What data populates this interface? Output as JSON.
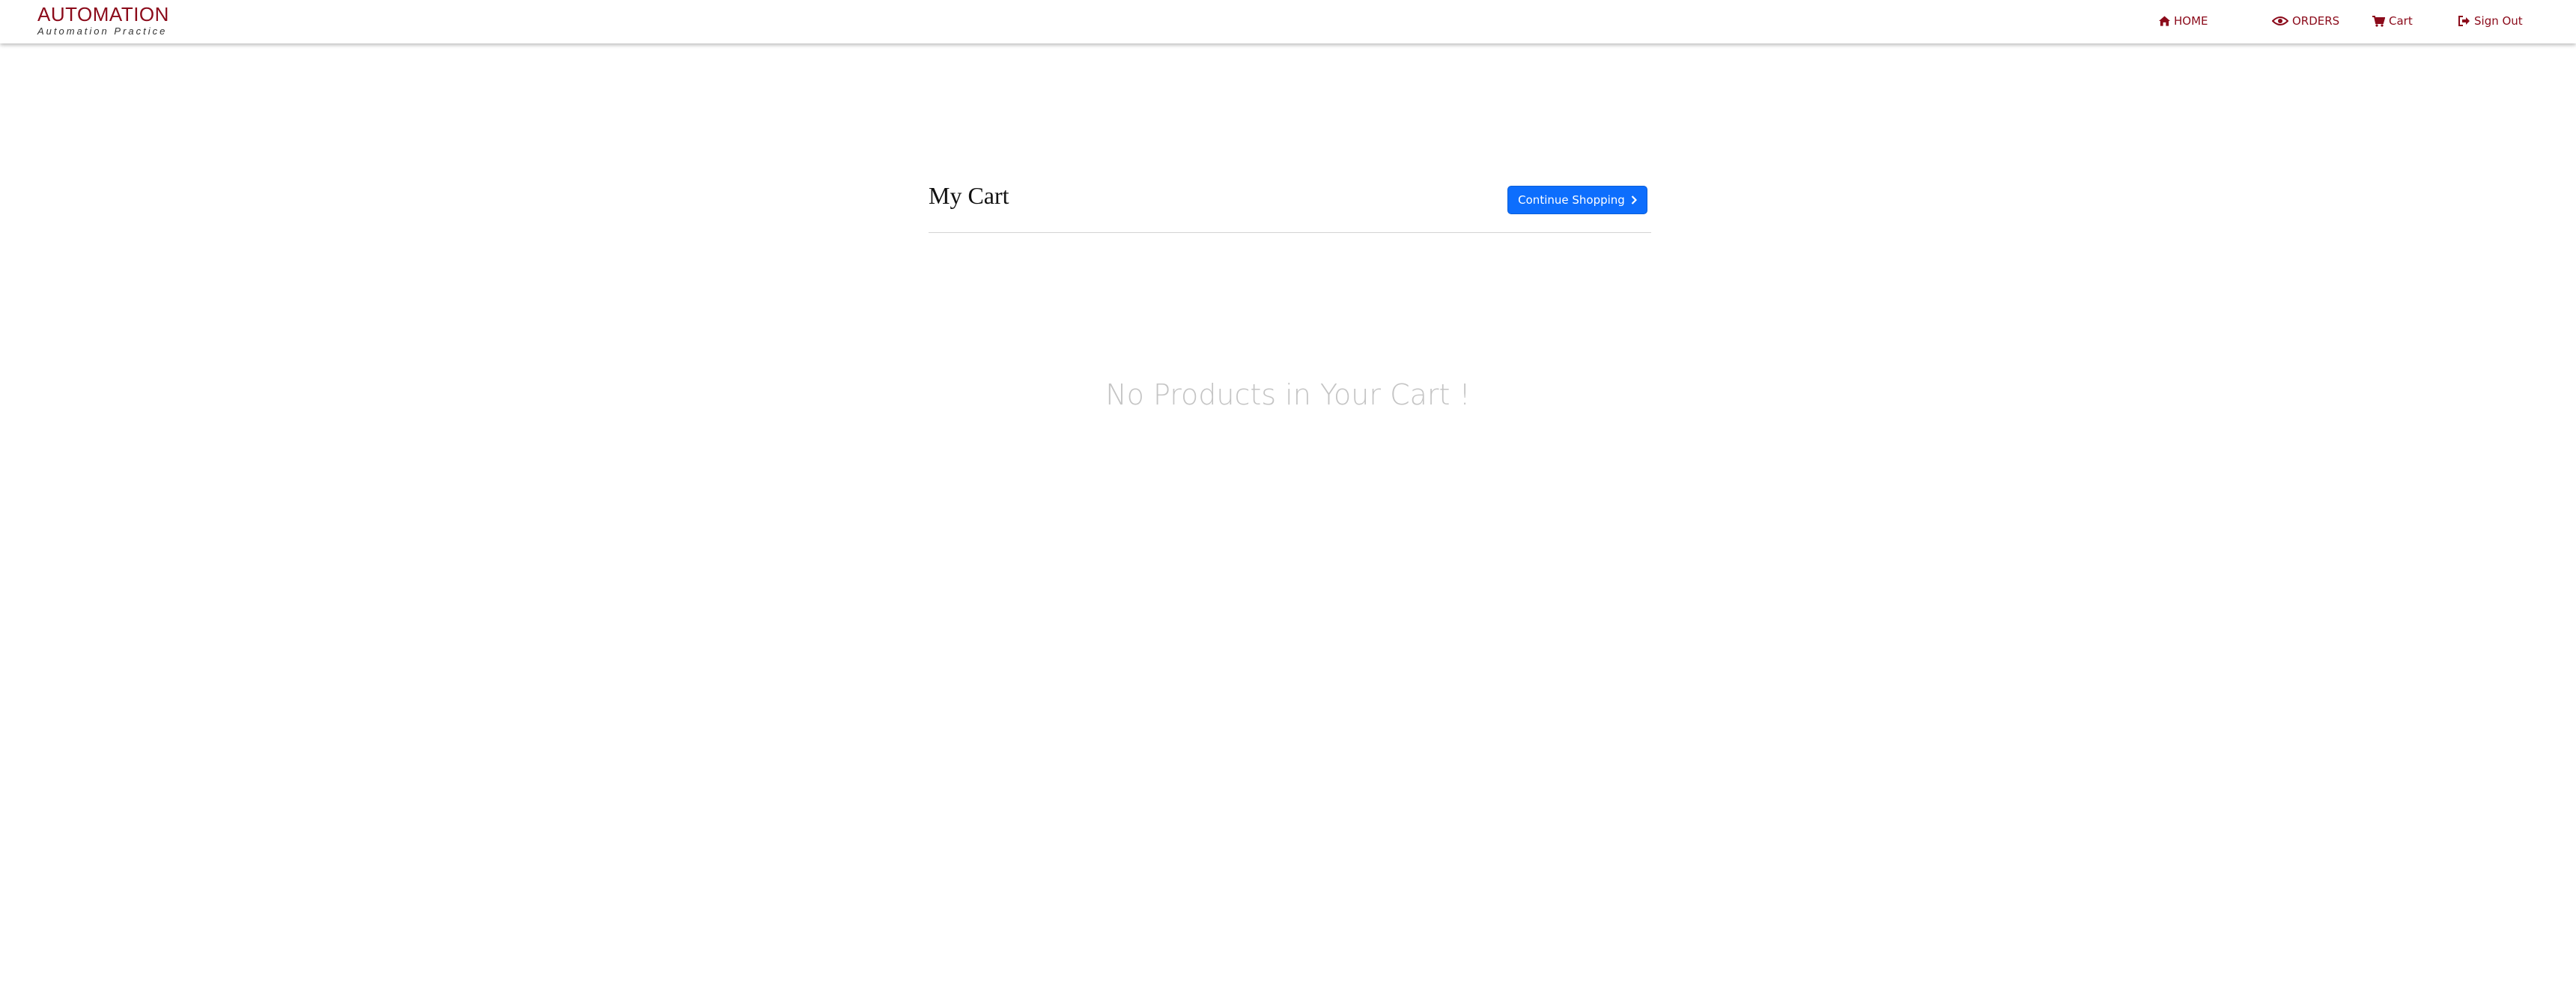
{
  "brand": {
    "title": "AUTOMATION",
    "subtitle": "Automation Practice"
  },
  "nav": {
    "home": {
      "label": "HOME",
      "icon": "home-icon"
    },
    "orders": {
      "label": "ORDERS",
      "icon": "eye-icon"
    },
    "cart": {
      "label": "Cart",
      "icon": "cart-icon"
    },
    "signout": {
      "label": "Sign Out",
      "icon": "sign-out-icon"
    }
  },
  "cart": {
    "title": "My Cart",
    "continue_label": "Continue Shopping",
    "empty_message": "No Products in Your Cart !"
  },
  "colors": {
    "brand": "#8b0a1a",
    "primary": "#0d6efd",
    "muted": "#c4c4c4"
  }
}
